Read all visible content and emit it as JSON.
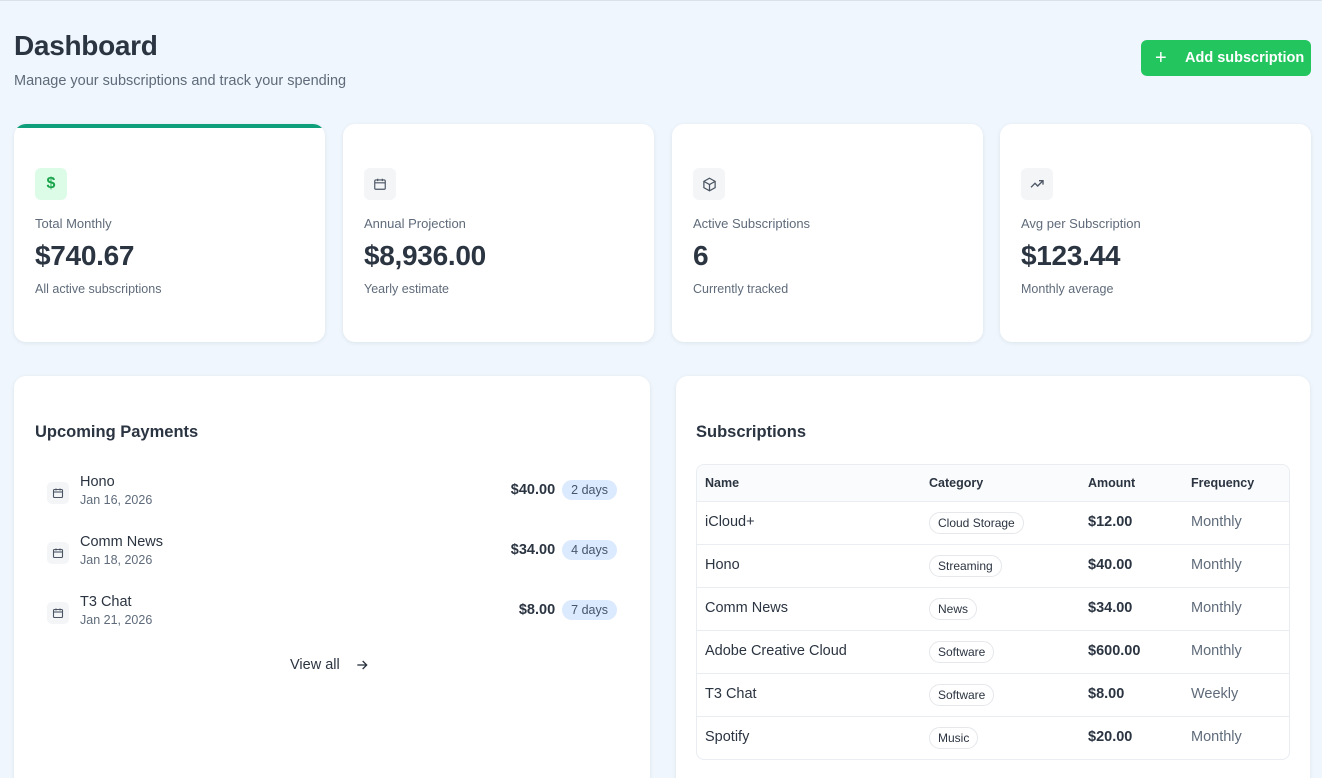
{
  "header": {
    "title": "Dashboard",
    "subtitle": "Manage your subscriptions and track your spending",
    "add_button_label": "Add subscription"
  },
  "stats": [
    {
      "icon": "dollar-icon",
      "label": "Total Monthly",
      "value": "$740.67",
      "note": "All active subscriptions"
    },
    {
      "icon": "calendar-icon",
      "label": "Annual Projection",
      "value": "$8,936.00",
      "note": "Yearly estimate"
    },
    {
      "icon": "box-icon",
      "label": "Active Subscriptions",
      "value": "6",
      "note": "Currently tracked"
    },
    {
      "icon": "trending-up-icon",
      "label": "Avg per Subscription",
      "value": "$123.44",
      "note": "Monthly average"
    }
  ],
  "upcoming": {
    "title": "Upcoming Payments",
    "items": [
      {
        "name": "Hono",
        "date": "Jan 16, 2026",
        "amount": "$40.00",
        "due": "2 days"
      },
      {
        "name": "Comm News",
        "date": "Jan 18, 2026",
        "amount": "$34.00",
        "due": "4 days"
      },
      {
        "name": "T3 Chat",
        "date": "Jan 21, 2026",
        "amount": "$8.00",
        "due": "7 days"
      }
    ],
    "view_all_label": "View all"
  },
  "subscriptions": {
    "title": "Subscriptions",
    "columns": [
      "Name",
      "Category",
      "Amount",
      "Frequency"
    ],
    "rows": [
      {
        "name": "iCloud+",
        "category": "Cloud Storage",
        "amount": "$12.00",
        "frequency": "Monthly"
      },
      {
        "name": "Hono",
        "category": "Streaming",
        "amount": "$40.00",
        "frequency": "Monthly"
      },
      {
        "name": "Comm News",
        "category": "News",
        "amount": "$34.00",
        "frequency": "Monthly"
      },
      {
        "name": "Adobe Creative Cloud",
        "category": "Software",
        "amount": "$600.00",
        "frequency": "Monthly"
      },
      {
        "name": "T3 Chat",
        "category": "Software",
        "amount": "$8.00",
        "frequency": "Weekly"
      },
      {
        "name": "Spotify",
        "category": "Music",
        "amount": "$20.00",
        "frequency": "Monthly"
      }
    ]
  },
  "colors": {
    "background": "#eff6fd",
    "accent_green": "#22c55e",
    "card_accent": "#0f9f7a",
    "badge_blue": "#dbeafe"
  }
}
